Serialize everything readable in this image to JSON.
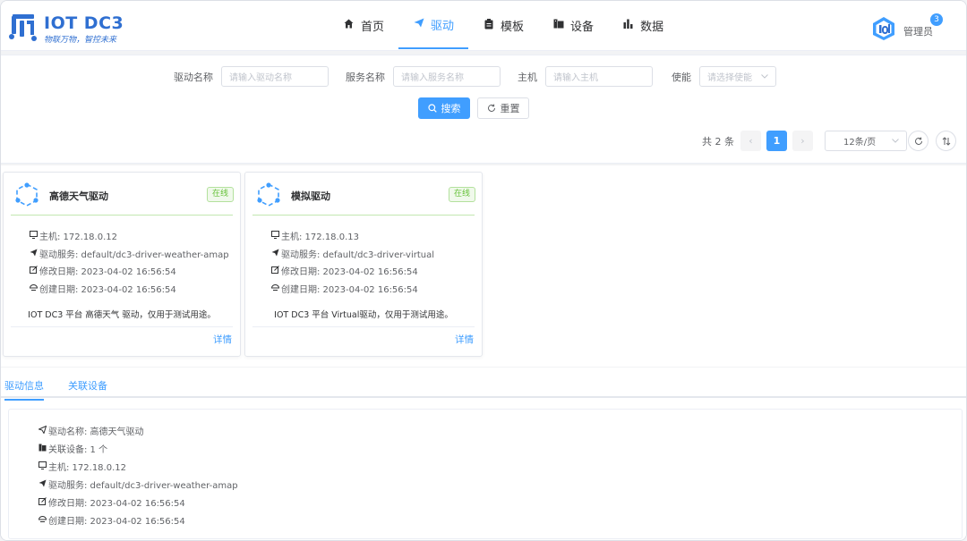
{
  "app": {
    "logo_text": "IOT DC3",
    "slogan": "物联万物，智控未来"
  },
  "nav": [
    {
      "label": "首页",
      "icon": "home-icon"
    },
    {
      "label": "驱动",
      "icon": "send-icon",
      "active": true
    },
    {
      "label": "模板",
      "icon": "clipboard-icon"
    },
    {
      "label": "设备",
      "icon": "device-icon"
    },
    {
      "label": "数据",
      "icon": "bar-chart-icon"
    }
  ],
  "user": {
    "name": "管理员",
    "badge": "3"
  },
  "search": {
    "fields": [
      {
        "label": "驱动名称",
        "placeholder": "请输入驱动名称"
      },
      {
        "label": "服务名称",
        "placeholder": "请输入服务名称"
      },
      {
        "label": "主机",
        "placeholder": "请输入主机"
      },
      {
        "label": "使能",
        "placeholder": "请选择使能"
      }
    ],
    "search_label": "搜索",
    "reset_label": "重置"
  },
  "pagination": {
    "total_text": "共 2 条",
    "prev": "‹",
    "current": "1",
    "next": "›",
    "page_size": "12条/页"
  },
  "cards": [
    {
      "title": "高德天气驱动",
      "status": "在线",
      "host": "主机: 172.18.0.12",
      "service": "驱动服务: default/dc3-driver-weather-amap",
      "updated": "修改日期: 2023-04-02 16:56:54",
      "created": "创建日期: 2023-04-02 16:56:54",
      "desc": "IOT DC3 平台 高德天气 驱动，仅用于测试用途。",
      "link": "详情"
    },
    {
      "title": "模拟驱动",
      "status": "在线",
      "host": "主机: 172.18.0.13",
      "service": "驱动服务: default/dc3-driver-virtual",
      "updated": "修改日期: 2023-04-02 16:56:54",
      "created": "创建日期: 2023-04-02 16:56:54",
      "desc": "IOT DC3 平台 Virtual驱动，仅用于测试用途。",
      "link": "详情"
    }
  ],
  "tabs": [
    {
      "label": "驱动信息",
      "active": true
    },
    {
      "label": "关联设备"
    }
  ],
  "detail": {
    "name": "驱动名称: 高德天气驱动",
    "devices": "关联设备: 1 个",
    "host": "主机: 172.18.0.12",
    "service": "驱动服务: default/dc3-driver-weather-amap",
    "updated": "修改日期: 2023-04-02 16:56:54",
    "created": "创建日期: 2023-04-02 16:56:54"
  },
  "colors": {
    "accent": "#409eff",
    "success": "#67c23a",
    "brand": "#2f6fd1"
  }
}
